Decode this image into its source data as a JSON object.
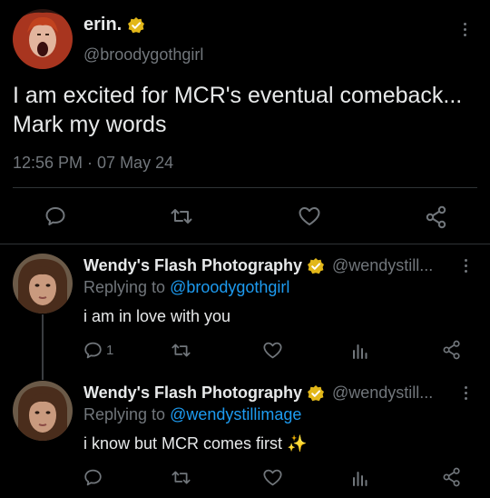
{
  "main_tweet": {
    "name": "erin.",
    "handle": "@broodygothgirl",
    "text": "I am excited for MCR's eventual comeback... Mark my words",
    "timestamp": "12:56 PM · 07 May 24",
    "actions": [
      "reply-icon",
      "retweet-icon",
      "like-icon",
      "share-icon"
    ]
  },
  "replies": [
    {
      "name": "Wendy's Flash Photography",
      "handle": "@wendystill...",
      "replying_prefix": "Replying to",
      "replying_to": "@broodygothgirl",
      "text": "i am in love with you",
      "reply_count": "1",
      "actions": [
        "reply-icon",
        "retweet-icon",
        "like-icon",
        "views-icon",
        "share-icon"
      ]
    },
    {
      "name": "Wendy's Flash Photography",
      "handle": "@wendystill...",
      "replying_prefix": "Replying to",
      "replying_to": "@wendystillimage",
      "text": "i know but MCR comes first ✨",
      "reply_count": "",
      "actions": [
        "reply-icon",
        "retweet-icon",
        "like-icon",
        "views-icon",
        "share-icon"
      ]
    }
  ],
  "colors": {
    "background": "#000000",
    "text": "#e7e9ea",
    "secondary": "#71767b",
    "link": "#1d9bf0",
    "verified_badge": "#e2b719"
  }
}
